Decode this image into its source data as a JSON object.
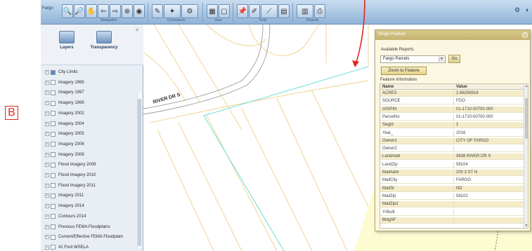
{
  "annotation": {
    "letter": "B",
    "arrow_color": "#e0281e"
  },
  "toolbar": {
    "brand": "Fargo",
    "groups": [
      "Navigation",
      "Commands",
      "View",
      "Tools",
      "Reports"
    ]
  },
  "left_panel": {
    "tabs": [
      {
        "label": "Layers",
        "icon": "layers-icon"
      },
      {
        "label": "Transparency",
        "icon": "transparency-icon"
      }
    ],
    "layers": [
      {
        "label": "City Limits",
        "checked": true
      },
      {
        "label": "Imagery 1995",
        "checked": false
      },
      {
        "label": "Imagery 1997",
        "checked": false
      },
      {
        "label": "Imagery 1999",
        "checked": false
      },
      {
        "label": "Imagery 2002",
        "checked": false
      },
      {
        "label": "Imagery 2004",
        "checked": false
      },
      {
        "label": "Imagery 2005",
        "checked": false
      },
      {
        "label": "Imagery 2006",
        "checked": false
      },
      {
        "label": "Imagery 2008",
        "checked": false
      },
      {
        "label": "Flood Imagery 2009",
        "checked": false
      },
      {
        "label": "Flood Imagery 2010",
        "checked": false
      },
      {
        "label": "Flood Imagery 2011",
        "checked": false
      },
      {
        "label": "Imagery 2011",
        "checked": false
      },
      {
        "label": "Imagery 2014",
        "checked": false
      },
      {
        "label": "Contours 2014",
        "checked": false
      },
      {
        "label": "Previous FEMA Floodplains",
        "checked": false
      },
      {
        "label": "Current/Effective FEMA Floodplain",
        "checked": false
      },
      {
        "label": "41 Foot WSELA",
        "checked": false
      }
    ]
  },
  "map": {
    "street_label": "RIVER DR S",
    "colors": {
      "parcel_line": "#f2cf8a",
      "road_line": "#9a9a9a",
      "highlight_line": "#68e0d6",
      "flood_fill": "#fdfbd0"
    }
  },
  "dialog": {
    "title": "Single Feature",
    "available_reports_label": "Available Reports",
    "report_value": "Fargo Parcels",
    "go_label": "Go",
    "zoom_label": "Zoom to Feature",
    "feature_info_label": "Feature Information",
    "columns": [
      "Name",
      "Value"
    ],
    "rows": [
      [
        "ACRES",
        "2.66256916"
      ],
      [
        "SOURCE",
        "FGO"
      ],
      [
        "GISPIN",
        "01-1710-00700-000"
      ],
      [
        "ParcelNo",
        "01-1710-00700-000"
      ],
      [
        "SegId",
        "1"
      ],
      [
        "Year_",
        "2016"
      ],
      [
        "Owner1",
        "CITY OF FARGO"
      ],
      [
        "Owner2",
        ""
      ],
      [
        "LandAddr",
        "3638 RIVER DR S"
      ],
      [
        "LandZip",
        "58104"
      ],
      [
        "MailAddr",
        "200 3 ST N"
      ],
      [
        "MailCity",
        "FARGO"
      ],
      [
        "MailSt",
        "ND"
      ],
      [
        "MailZip",
        "58102"
      ],
      [
        "MailZip2",
        ""
      ],
      [
        "YrBuilt",
        ""
      ],
      [
        "BldgSF",
        ""
      ]
    ]
  }
}
